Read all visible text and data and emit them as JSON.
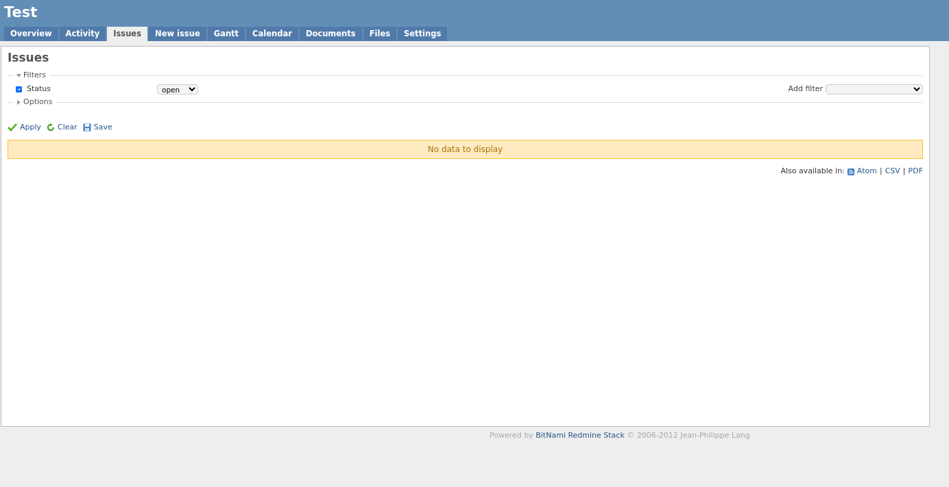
{
  "project_title": "Test",
  "tabs": [
    {
      "label": "Overview",
      "selected": false
    },
    {
      "label": "Activity",
      "selected": false
    },
    {
      "label": "Issues",
      "selected": true
    },
    {
      "label": "New issue",
      "selected": false
    },
    {
      "label": "Gantt",
      "selected": false
    },
    {
      "label": "Calendar",
      "selected": false
    },
    {
      "label": "Documents",
      "selected": false
    },
    {
      "label": "Files",
      "selected": false
    },
    {
      "label": "Settings",
      "selected": false
    }
  ],
  "page_title": "Issues",
  "filters": {
    "legend": "Filters",
    "expanded": true,
    "rows": [
      {
        "label": "Status",
        "checked": true,
        "operator": "open"
      }
    ],
    "add_filter_label": "Add filter"
  },
  "options": {
    "legend": "Options",
    "expanded": false
  },
  "actions": [
    {
      "kind": "apply",
      "label": "Apply"
    },
    {
      "kind": "clear",
      "label": "Clear"
    },
    {
      "kind": "save",
      "label": "Save"
    }
  ],
  "notice": "No data to display",
  "export": {
    "label": "Also available in:",
    "separator": "|",
    "formats": [
      {
        "kind": "feed",
        "label": "Atom"
      },
      {
        "kind": "plain",
        "label": "CSV"
      },
      {
        "kind": "plain",
        "label": "PDF"
      }
    ]
  },
  "footer": {
    "prefix": "Powered by",
    "link": "BitNami Redmine Stack",
    "suffix": "© 2006-2012 Jean-Philippe Lang"
  }
}
